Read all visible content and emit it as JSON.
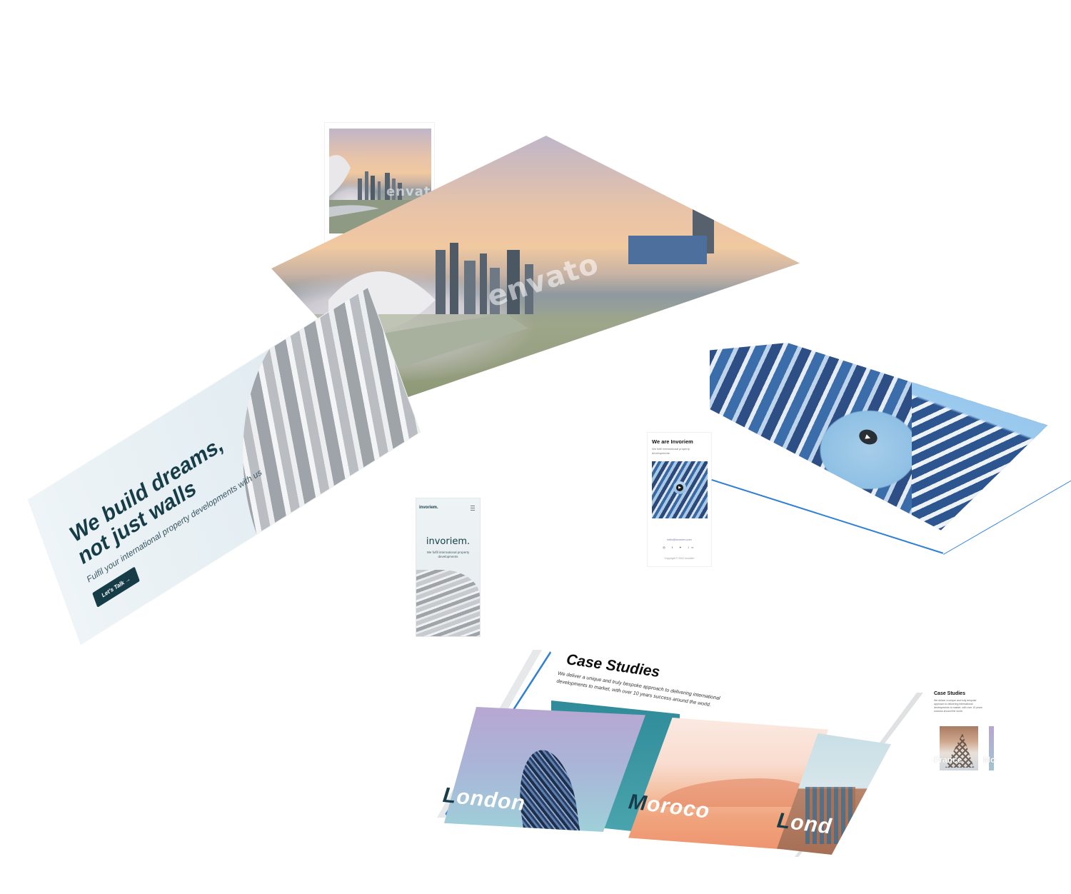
{
  "hero": {
    "title_line1": "We build dreams,",
    "title_line2": "not just walls",
    "subtitle": "Fulfil your international property developments with us",
    "cta": "Let's Talk →"
  },
  "watermark": "envato",
  "mobile": {
    "logo_small": "invoriem.",
    "logo_big": "invoriem.",
    "tagline": "We fulfil international property developments"
  },
  "about": {
    "title": "We are Invoriem",
    "subtitle": "We fulfil international property developments",
    "email": "hello@invoriem.com",
    "social": "◎ f ✦ in",
    "copyright": "Copyright © 2022 Invoriem"
  },
  "case_studies": {
    "title": "Case Studies",
    "description": "We deliver a unique and truly bespoke approach to delivering international developments to market, with over 10 years success around the world.",
    "cards": [
      {
        "first": "L",
        "rest": "ondon"
      },
      {
        "first": "M",
        "rest": "oroco"
      },
      {
        "first": "L",
        "rest": "ond"
      }
    ]
  },
  "mini_case": {
    "title": "Case Studies",
    "description": "We deliver a unique and truly bespoke approach to delivering international developments to market, with over 10 years success around the world.",
    "card1": "France",
    "card2": "Mo"
  },
  "colors": {
    "brand_dark": "#163d47",
    "accent_blue": "#2f7fd6"
  }
}
